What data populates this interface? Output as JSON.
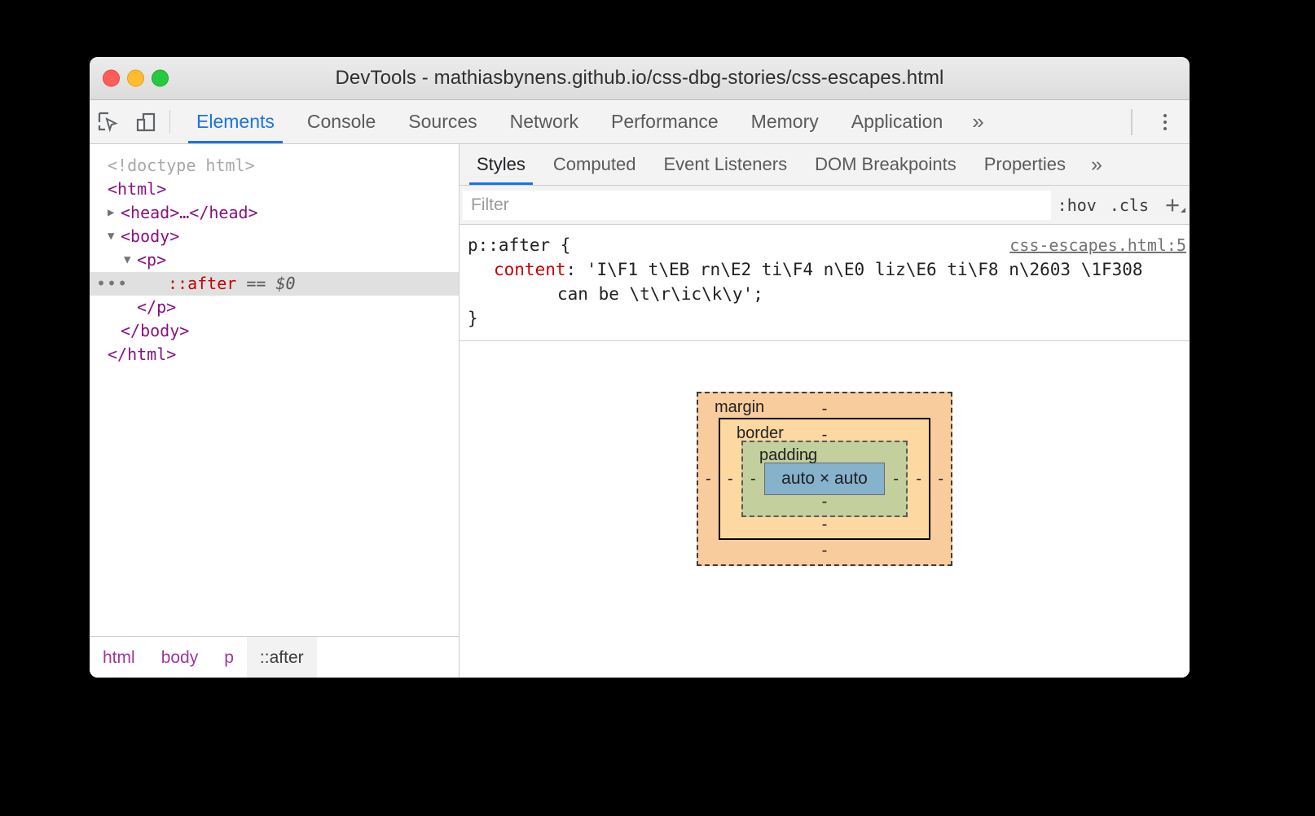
{
  "window": {
    "title": "DevTools - mathiasbynens.github.io/css-dbg-stories/css-escapes.html",
    "traffic": {
      "close": "close",
      "minimize": "minimize",
      "zoom": "zoom"
    }
  },
  "toolbar": {
    "inspect_icon": "inspect-element-icon",
    "device_icon": "device-toolbar-icon",
    "tabs": [
      {
        "label": "Elements",
        "active": true
      },
      {
        "label": "Console",
        "active": false
      },
      {
        "label": "Sources",
        "active": false
      },
      {
        "label": "Network",
        "active": false
      },
      {
        "label": "Performance",
        "active": false
      },
      {
        "label": "Memory",
        "active": false
      },
      {
        "label": "Application",
        "active": false
      }
    ],
    "more_tabs": "»",
    "menu_icon": "kebab-menu-icon"
  },
  "dom_tree": {
    "nodes": [
      {
        "text": "<!doctype html>"
      },
      {
        "text": "<html>"
      },
      {
        "text": "<head>…</head>",
        "twisty": "▶"
      },
      {
        "text": "<body>",
        "twisty": "▼"
      },
      {
        "text": "<p>",
        "twisty": "▼"
      },
      {
        "pseudo": "::after",
        "eq": "==",
        "dollar": "$0",
        "dots": "•••"
      },
      {
        "text": "</p>"
      },
      {
        "text": "</body>"
      },
      {
        "text": "</html>"
      }
    ]
  },
  "breadcrumb": {
    "items": [
      {
        "label": "html",
        "selected": false
      },
      {
        "label": "body",
        "selected": false
      },
      {
        "label": "p",
        "selected": false
      },
      {
        "label": "::after",
        "selected": true
      }
    ]
  },
  "styles_panel": {
    "tabs": [
      {
        "label": "Styles",
        "active": true
      },
      {
        "label": "Computed",
        "active": false
      },
      {
        "label": "Event Listeners",
        "active": false
      },
      {
        "label": "DOM Breakpoints",
        "active": false
      },
      {
        "label": "Properties",
        "active": false
      }
    ],
    "more_tabs": "»",
    "filter": {
      "value": "",
      "placeholder": "Filter"
    },
    "hov_button": ":hov",
    "cls_button": ".cls",
    "new_rule_button": "+",
    "rule": {
      "selector": "p::after {",
      "source": "css-escapes.html:5",
      "property": "content",
      "colon": ":",
      "value_line1": "'I\\F1 t\\EB rn\\E2 ti\\F4 n\\E0 liz\\E6 ti\\F8 n\\2603 \\1F308",
      "value_line2": "can be \\t\\r\\ic\\k\\y';",
      "close_brace": "}"
    }
  },
  "box_model": {
    "margin_label": "margin",
    "border_label": "border",
    "padding_label": "padding",
    "content_label": "auto × auto",
    "dash": "-",
    "colors": {
      "margin": "#f9cc9d",
      "border": "#fdd8a1",
      "padding": "#c3cf9d",
      "content": "#87b2cc"
    }
  }
}
